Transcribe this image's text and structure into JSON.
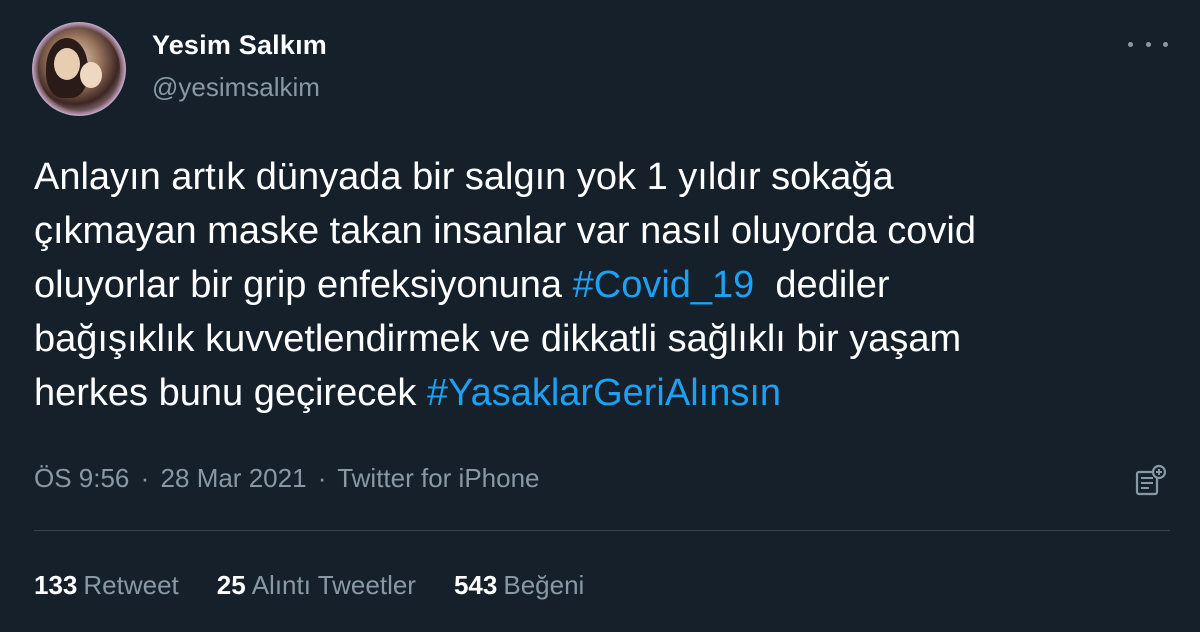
{
  "author": {
    "display_name": "Yesim Salkım",
    "handle": "@yesimsalkim"
  },
  "tweet": {
    "lines": [
      [
        {
          "text": "Anlayın artık dünyada bir salgın yok 1 yıldır sokağa"
        }
      ],
      [
        {
          "text": "çıkmayan maske takan insanlar var nasıl oluyorda covid"
        }
      ],
      [
        {
          "text": "oluyorlar bir grip enfeksiyonuna "
        },
        {
          "text": "#Covid_19",
          "hashtag": true
        },
        {
          "text": "  dediler"
        }
      ],
      [
        {
          "text": "bağışıklık kuvvetlendirmek ve dikkatli sağlıklı bir yaşam"
        }
      ],
      [
        {
          "text": "herkes bunu geçirecek "
        },
        {
          "text": "#YasaklarGeriAlınsın",
          "hashtag": true
        }
      ]
    ]
  },
  "meta": {
    "time": "ÖS 9:56",
    "separator": "·",
    "date": "28 Mar 2021",
    "source": "Twitter for iPhone"
  },
  "stats": {
    "retweets": {
      "count": "133",
      "label": "Retweet"
    },
    "quotes": {
      "count": "25",
      "label": "Alıntı Tweetler"
    },
    "likes": {
      "count": "543",
      "label": "Beğeni"
    }
  },
  "icons": {
    "more": "more-horizontal-icon",
    "analytics": "analytics-icon"
  },
  "colors": {
    "background": "#15202b",
    "hashtag": "#1da1f2",
    "secondary_text": "#8899a6",
    "divider": "#38444d"
  }
}
